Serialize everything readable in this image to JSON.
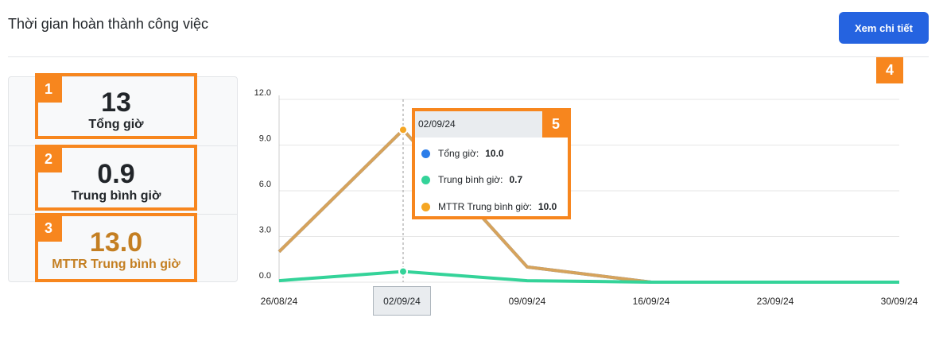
{
  "header": {
    "title": "Thời gian hoàn thành công việc",
    "detail_button": "Xem chi tiết"
  },
  "stats": [
    {
      "value": "13",
      "label": "Tổng giờ",
      "badge": "1"
    },
    {
      "value": "0.9",
      "label": "Trung bình giờ",
      "badge": "2"
    },
    {
      "value": "13.0",
      "label": "MTTR Trung bình giờ",
      "badge": "3"
    }
  ],
  "badges": {
    "button": "4",
    "tooltip": "5"
  },
  "tooltip": {
    "date": "02/09/24",
    "rows": [
      {
        "label": "Tổng giờ:",
        "value": "10.0",
        "color": "#2b7de9"
      },
      {
        "label": "Trung bình giờ:",
        "value": "0.7",
        "color": "#34d399"
      },
      {
        "label": "MTTR Trung bình giờ:",
        "value": "10.0",
        "color": "#f5a623"
      }
    ]
  },
  "hover_x_label": "02/09/24",
  "chart_data": {
    "type": "line",
    "x": [
      "26/08/24",
      "02/09/24",
      "09/09/24",
      "16/09/24",
      "23/09/24",
      "30/09/24"
    ],
    "yticks": [
      "0.0",
      "3.0",
      "6.0",
      "9.0",
      "12.0"
    ],
    "ylim": [
      0,
      12
    ],
    "series": [
      {
        "name": "Tổng giờ",
        "color": "#2b7de9",
        "values": [
          2.0,
          10.0,
          1.0,
          0,
          0,
          0
        ]
      },
      {
        "name": "MTTR Trung bình giờ",
        "color": "#d6a35c",
        "values": [
          2.0,
          10.0,
          1.0,
          0,
          0,
          0
        ]
      },
      {
        "name": "Trung bình giờ",
        "color": "#34d399",
        "values": [
          0.1,
          0.7,
          0.1,
          0,
          0,
          0
        ]
      }
    ]
  }
}
